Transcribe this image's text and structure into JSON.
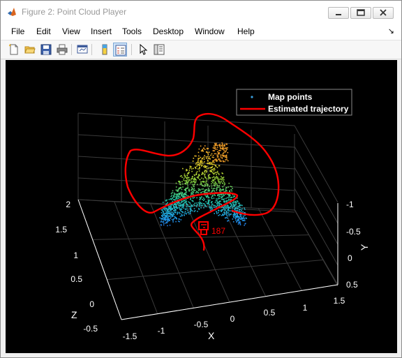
{
  "window": {
    "title": "Figure 2: Point Cloud Player"
  },
  "menu": {
    "items": [
      "File",
      "Edit",
      "View",
      "Insert",
      "Tools",
      "Desktop",
      "Window",
      "Help"
    ],
    "dock_arrow": "↘"
  },
  "toolbar": {
    "buttons": [
      "new-figure",
      "open-file",
      "save",
      "print",
      "link-plot",
      "hide-plot-tools",
      "show-plot-tools",
      "edit-plot",
      "insert-legend"
    ]
  },
  "plot": {
    "legend": {
      "map_points": "Map points",
      "trajectory": "Estimated trajectory"
    },
    "axes": {
      "x_label": "X",
      "y_label": "Y",
      "z_label": "Z",
      "x_ticks": [
        "-1.5",
        "-1",
        "-0.5",
        "0",
        "0.5",
        "1",
        "1.5"
      ],
      "y_ticks": [
        "-1",
        "-0.5",
        "0",
        "0.5"
      ],
      "z_ticks": [
        "2",
        "1.5",
        "1",
        "0.5",
        "0",
        "-0.5"
      ]
    },
    "camera_label": "187",
    "colors": {
      "trajectory": "#ff0000",
      "background": "#000000",
      "grid": "#3a3a3a",
      "tick_text": "#ffffff"
    }
  }
}
